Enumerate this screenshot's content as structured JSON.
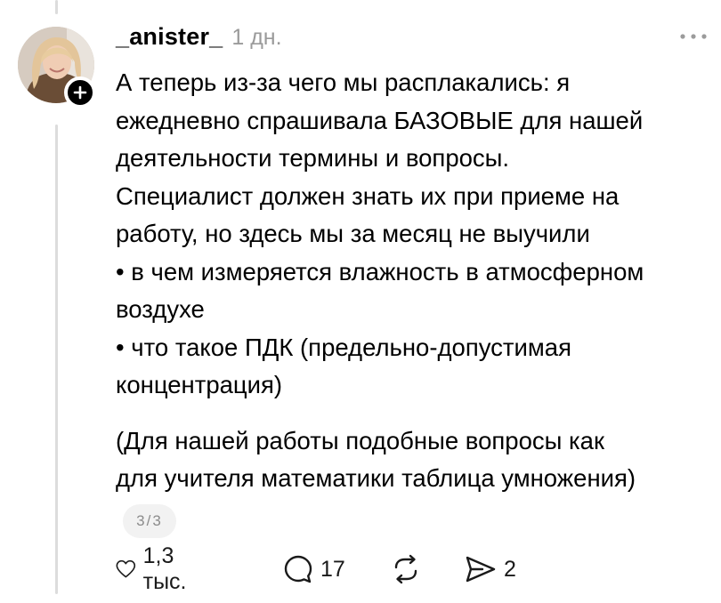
{
  "post": {
    "username": "_anister_",
    "time": "1 дн.",
    "lines": [
      "А теперь из-за чего мы расплакались: я",
      "ежедневно спрашивала БАЗОВЫЕ для нашей",
      "деятельности термины и вопросы.",
      "Специалист должен знать их при приеме на",
      "работу, но здесь мы за месяц не выучили",
      "• в чем измеряется влажность в атмосферном",
      "воздухе",
      "• что такое ПДК (предельно-допустимая",
      "концентрация)",
      "",
      "(Для нашей работы подобные вопросы как",
      "для учителя математики таблица умножения)"
    ],
    "page_indicator": "3/3"
  },
  "actions": {
    "likes": "1,3 тыс.",
    "replies": "17",
    "shares": "2"
  },
  "icons": {
    "follow": "plus-icon",
    "more": "more-horizontal-icon",
    "like": "heart-icon",
    "reply": "comment-icon",
    "repost": "repost-icon",
    "share": "send-icon"
  }
}
